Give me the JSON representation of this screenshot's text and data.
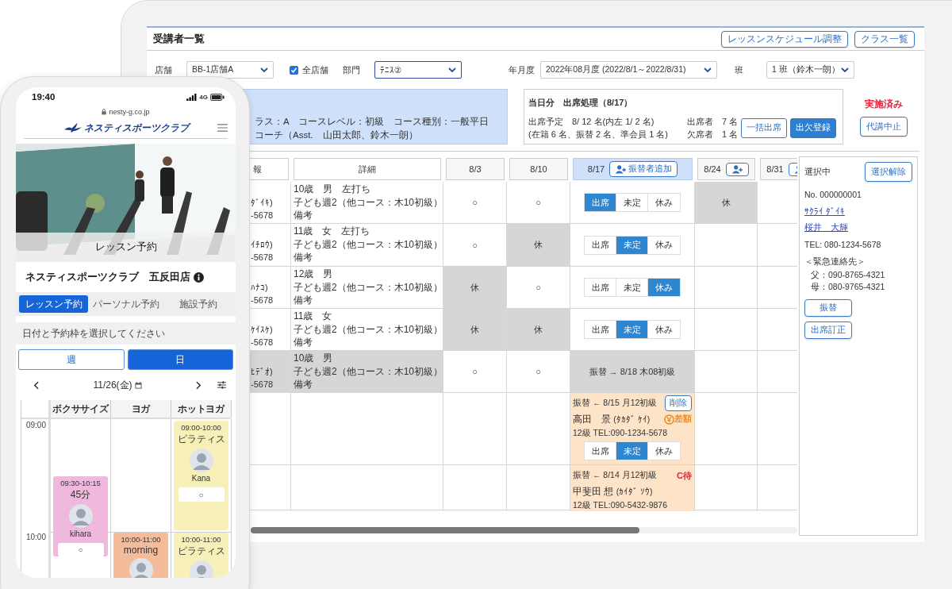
{
  "tablet": {
    "title": "受講者一覧",
    "header_buttons": [
      "レッスンスケジュール調整",
      "クラス一覧"
    ],
    "filters": [
      {
        "kind": "select",
        "label": "店舗",
        "value": "BB-1店舗A",
        "focused": false
      },
      {
        "kind": "checkbox",
        "label": "全店舗",
        "checked": true
      },
      {
        "kind": "select",
        "label": "部門",
        "value": "ﾃﾆｽ②",
        "focused": true
      },
      {
        "kind": "select",
        "label": "年月度",
        "value": "2022年08月度 (2022/8/1～2022/8/31)",
        "focused": false
      },
      {
        "kind": "select",
        "label": "班",
        "value": "1 班（鈴木一朗）",
        "focused": false
      }
    ],
    "class_info": [
      "ラス：A　コースレベル：初級　コース種別：一般平日",
      "コーチ（Asst.　山田太郎、鈴木一朗）"
    ],
    "summary": {
      "title": "当日分　出席処理（8/17）",
      "planned": "出席予定　8/ 12 名(内左 1/ 2 名)",
      "breakdown": "(在籍 6 名、振替 2 名、準会員 1 名)",
      "present": "出席者　7 名",
      "absent": "欠席者　1 名",
      "buttons": [
        {
          "label": "一括出席",
          "primary": false
        },
        {
          "label": "出欠登録",
          "primary": true
        }
      ]
    },
    "status": "実施済み",
    "cancel_button": "代講中止",
    "table": {
      "columns": [
        {
          "kind": "plain",
          "label": "報",
          "current": false
        },
        {
          "kind": "plain",
          "label": "詳細",
          "current": false
        },
        {
          "kind": "date",
          "label": "8/3",
          "current": false
        },
        {
          "kind": "date",
          "label": "8/10",
          "current": false
        },
        {
          "kind": "date_add",
          "label": "8/17",
          "current": true,
          "button": "振替者追加"
        },
        {
          "kind": "date_add",
          "label": "8/24",
          "current": false
        },
        {
          "kind": "date_add",
          "label": "8/31",
          "current": false
        }
      ],
      "rows": [
        {
          "greyed": false,
          "cells": [
            {
              "kind": "name",
              "name": "ﾀﾞｲｷ)",
              "tel": "-5678"
            },
            {
              "kind": "details",
              "lines": [
                "10歳　男　左打ち",
                "子ども週2（他コース：木10初級）",
                "備考"
              ]
            },
            {
              "kind": "mark",
              "text": "○"
            },
            {
              "kind": "mark",
              "text": "○"
            },
            {
              "kind": "attendance",
              "options": [
                {
                  "label": "出席",
                  "selected": true
                },
                {
                  "label": "未定",
                  "selected": false
                },
                {
                  "label": "休み",
                  "selected": false
                }
              ]
            },
            {
              "kind": "off",
              "text": "休"
            },
            {
              "kind": "empty"
            }
          ]
        },
        {
          "greyed": false,
          "cells": [
            {
              "kind": "name",
              "name": "ｲﾁﾛｳ)",
              "tel": "-5678"
            },
            {
              "kind": "details",
              "lines": [
                "11歳　女　左打ち",
                "子ども週2（他コース：木10初級）",
                "備考"
              ]
            },
            {
              "kind": "mark",
              "text": "○"
            },
            {
              "kind": "off",
              "text": "休"
            },
            {
              "kind": "attendance",
              "options": [
                {
                  "label": "出席",
                  "selected": false
                },
                {
                  "label": "未定",
                  "selected": true
                },
                {
                  "label": "休み",
                  "selected": false
                }
              ]
            },
            {
              "kind": "empty"
            },
            {
              "kind": "empty"
            }
          ]
        },
        {
          "greyed": false,
          "cells": [
            {
              "kind": "name",
              "name": "ﾊﾅｺ)",
              "tel": "-5678"
            },
            {
              "kind": "details",
              "lines": [
                "12歳　男",
                "子ども週2（他コース：木10初級）",
                "備考"
              ]
            },
            {
              "kind": "off",
              "text": "休"
            },
            {
              "kind": "mark",
              "text": "○"
            },
            {
              "kind": "attendance",
              "options": [
                {
                  "label": "出席",
                  "selected": false
                },
                {
                  "label": "未定",
                  "selected": false
                },
                {
                  "label": "休み",
                  "selected": true
                }
              ]
            },
            {
              "kind": "empty"
            },
            {
              "kind": "empty"
            }
          ]
        },
        {
          "greyed": false,
          "cells": [
            {
              "kind": "name",
              "name": "ｹｲｽｹ)",
              "tel": "-5678"
            },
            {
              "kind": "details",
              "lines": [
                "11歳　女",
                "子ども週2（他コース：木10初級）",
                "備考"
              ]
            },
            {
              "kind": "off",
              "text": "休"
            },
            {
              "kind": "off",
              "text": "休"
            },
            {
              "kind": "attendance",
              "options": [
                {
                  "label": "出席",
                  "selected": false
                },
                {
                  "label": "未定",
                  "selected": true
                },
                {
                  "label": "休み",
                  "selected": false
                }
              ]
            },
            {
              "kind": "empty"
            },
            {
              "kind": "empty"
            }
          ]
        },
        {
          "greyed": true,
          "cells": [
            {
              "kind": "name",
              "name": "ﾋﾃﾞｵ)",
              "tel": "-5678"
            },
            {
              "kind": "details",
              "lines": [
                "10歳　男",
                "子ども週2（他コース：木10初級）",
                "備考"
              ]
            },
            {
              "kind": "mark",
              "text": "○"
            },
            {
              "kind": "mark",
              "text": "○"
            },
            {
              "kind": "transfer",
              "text": "振替 → 8/18 木08初級"
            },
            {
              "kind": "empty"
            },
            {
              "kind": "empty"
            }
          ]
        },
        {
          "greyed": false,
          "cells": [
            {
              "kind": "empty"
            },
            {
              "kind": "empty"
            },
            {
              "kind": "empty"
            },
            {
              "kind": "empty"
            },
            {
              "kind": "sub",
              "note": "振替 ← 8/15 月12初級",
              "delete_button": "削除",
              "name": "高田　景",
              "kana": "(ﾀｶﾀﾞ ｹｲ)",
              "badge": {
                "kind": "fee",
                "text": "差額"
              },
              "info": "12級 TEL:090-1234-5678",
              "options": [
                {
                  "label": "出席",
                  "selected": false
                },
                {
                  "label": "未定",
                  "selected": true
                },
                {
                  "label": "休み",
                  "selected": false
                }
              ]
            },
            {
              "kind": "empty"
            },
            {
              "kind": "empty"
            }
          ]
        },
        {
          "greyed": false,
          "cells": [
            {
              "kind": "empty"
            },
            {
              "kind": "empty"
            },
            {
              "kind": "empty"
            },
            {
              "kind": "empty"
            },
            {
              "kind": "sub",
              "note": "振替 ← 8/14 月12初級",
              "name": "甲斐田 想",
              "kana": "(ｶｲﾀﾞ ｿｳ)",
              "badge": {
                "kind": "wait",
                "text": "C待"
              },
              "info": "12級 TEL:090-5432-9876"
            },
            {
              "kind": "empty"
            },
            {
              "kind": "empty"
            }
          ]
        }
      ]
    },
    "selection": {
      "title": "選択中",
      "clear_button": "選択解除",
      "number": "No. 000000001",
      "kana": "ｻｸﾗｲ ﾀﾞｲｷ",
      "name": "桜井　大輝",
      "tel": "TEL: 080-1234-5678",
      "emergency_title": "＜緊急連絡先＞",
      "contacts": [
        "父：090-8765-4321",
        "母：080-9765-4321"
      ],
      "buttons": [
        "振替",
        "出席訂正"
      ]
    }
  },
  "phone": {
    "time": "19:40",
    "network": "4G",
    "url": "nesty-g.co.jp",
    "brand": "ネスティスポーツクラブ",
    "hero_title": "レッスン予約",
    "store": "ネスティスポーツクラブ　五反田店",
    "tabs": [
      {
        "label": "レッスン予約",
        "selected": true
      },
      {
        "label": "パーソナル予約",
        "selected": false
      },
      {
        "label": "施設予約",
        "selected": false
      }
    ],
    "prompt": "日付と予約枠を選択してください",
    "view_toggle": [
      {
        "label": "週",
        "selected": false
      },
      {
        "label": "日",
        "selected": true
      }
    ],
    "date": "11/26(金)",
    "schedule": {
      "times": [
        "09:00",
        "10:00"
      ],
      "columns": [
        {
          "name": "ボクササイズ",
          "events": [
            {
              "time": "09:30-10:15",
              "title": "45分",
              "instructor": "kihara",
              "slot": "○",
              "color": "#f1b8de"
            }
          ]
        },
        {
          "name": "ヨガ",
          "events": [
            {
              "time": "10:00-11:00",
              "title": "morning",
              "color": "#f5bc9c"
            }
          ]
        },
        {
          "name": "ホットヨガ",
          "events": [
            {
              "time": "09:00-10:00",
              "title": "ピラティス",
              "instructor": "Kana",
              "slot": "○",
              "color": "#f7f0b9"
            },
            {
              "time": "10:00-11:00",
              "title": "ピラティス",
              "color": "#f7f0b9"
            }
          ]
        }
      ]
    }
  }
}
